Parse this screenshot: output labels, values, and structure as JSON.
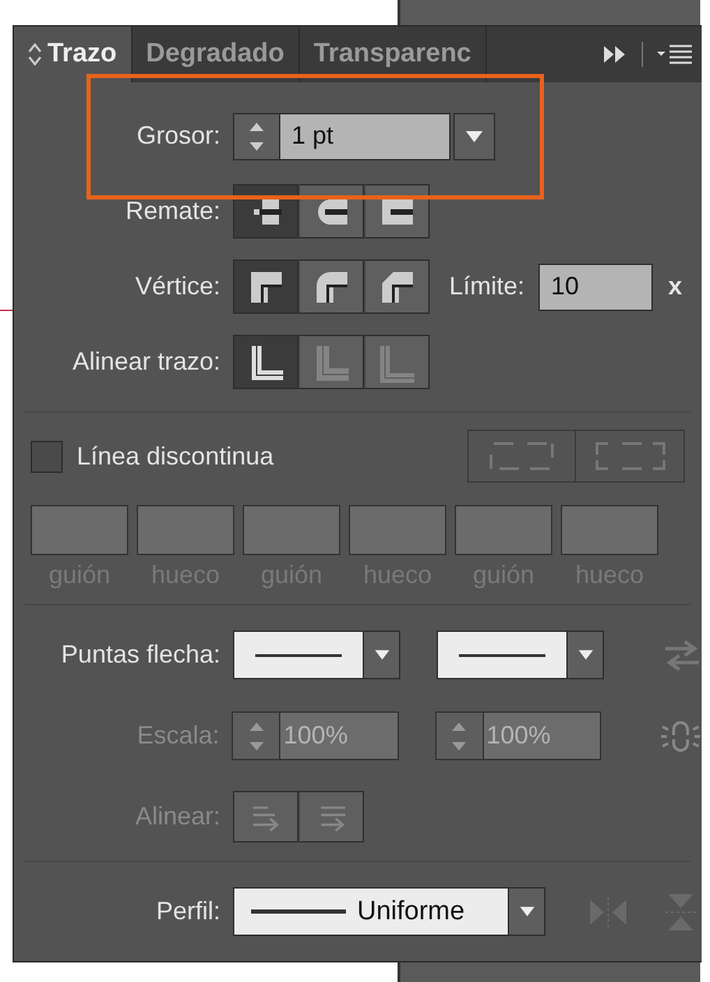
{
  "tabs": [
    {
      "label": "Trazo",
      "selected": true
    },
    {
      "label": "Degradado",
      "selected": false
    },
    {
      "label": "Transparenc",
      "selected": false
    }
  ],
  "weight": {
    "label": "Grosor:",
    "value": "1 pt",
    "highlighted": true
  },
  "cap": {
    "label": "Remate:",
    "buttons": [
      {
        "kind": "butt",
        "selected": true
      },
      {
        "kind": "round",
        "selected": false
      },
      {
        "kind": "projecting",
        "selected": false
      }
    ]
  },
  "corner": {
    "label": "Vértice:",
    "buttons": [
      {
        "kind": "miter",
        "selected": true
      },
      {
        "kind": "round",
        "selected": false
      },
      {
        "kind": "bevel",
        "selected": false
      }
    ],
    "limit_label": "Límite:",
    "limit_value": "10",
    "limit_unit": "x"
  },
  "align_stroke": {
    "label": "Alinear trazo:",
    "buttons": [
      {
        "kind": "center",
        "selected": true,
        "disabled": false
      },
      {
        "kind": "inside",
        "selected": false,
        "disabled": true
      },
      {
        "kind": "outside",
        "selected": false,
        "disabled": true
      }
    ]
  },
  "dashed": {
    "label": "Línea discontinua",
    "checked": false
  },
  "dash_fields": [
    {
      "label": "guión"
    },
    {
      "label": "hueco"
    },
    {
      "label": "guión"
    },
    {
      "label": "hueco"
    },
    {
      "label": "guión"
    },
    {
      "label": "hueco"
    }
  ],
  "arrowheads": {
    "label": "Puntas flecha:"
  },
  "scale": {
    "label": "Escala:",
    "values": [
      "100%",
      "100%"
    ],
    "disabled": true
  },
  "align_arrows": {
    "label": "Alinear:",
    "disabled": true
  },
  "profile": {
    "label": "Perfil:",
    "value": "Uniforme"
  }
}
